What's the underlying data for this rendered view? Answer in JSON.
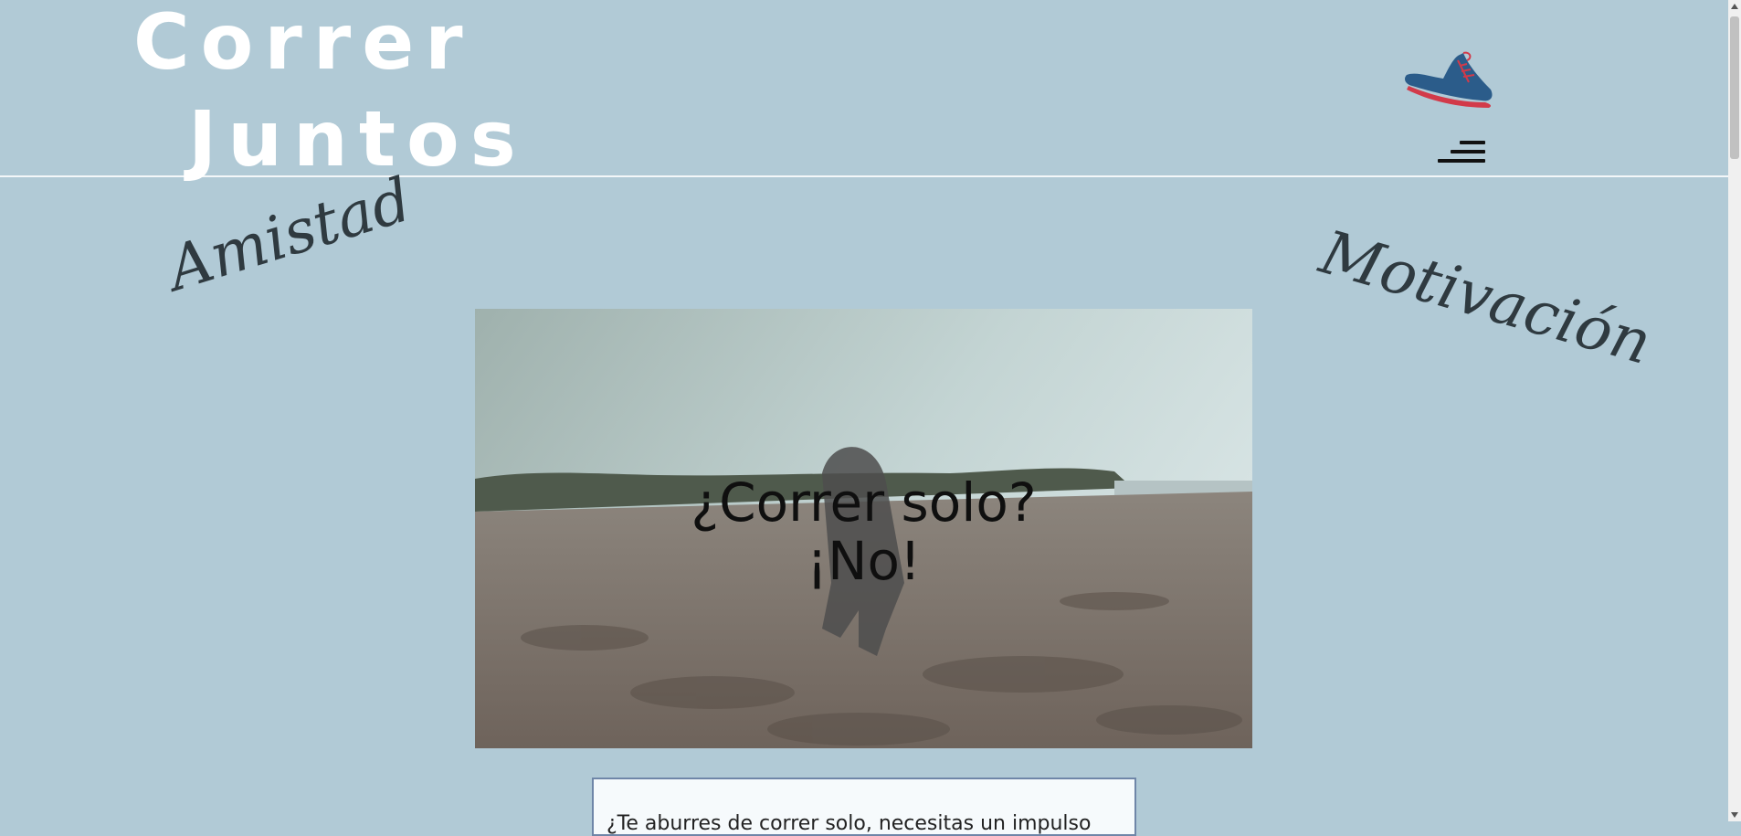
{
  "header": {
    "logo_line1": "Correr",
    "logo_line2": "Juntos",
    "shoe_icon": "running-shoe-icon",
    "menu_icon": "hamburger-menu-icon"
  },
  "decor": {
    "left_word": "Amistad",
    "right_word": "Motivación"
  },
  "hero": {
    "line1": "¿Correr solo?",
    "line2": "¡No!"
  },
  "promo": {
    "text": "¿Te aburres de correr solo, necesitas un impulso"
  },
  "colors": {
    "background": "#b1cad6",
    "logo": "#ffffff",
    "shoe_blue": "#2b5c8a",
    "shoe_red": "#d23a4a"
  }
}
